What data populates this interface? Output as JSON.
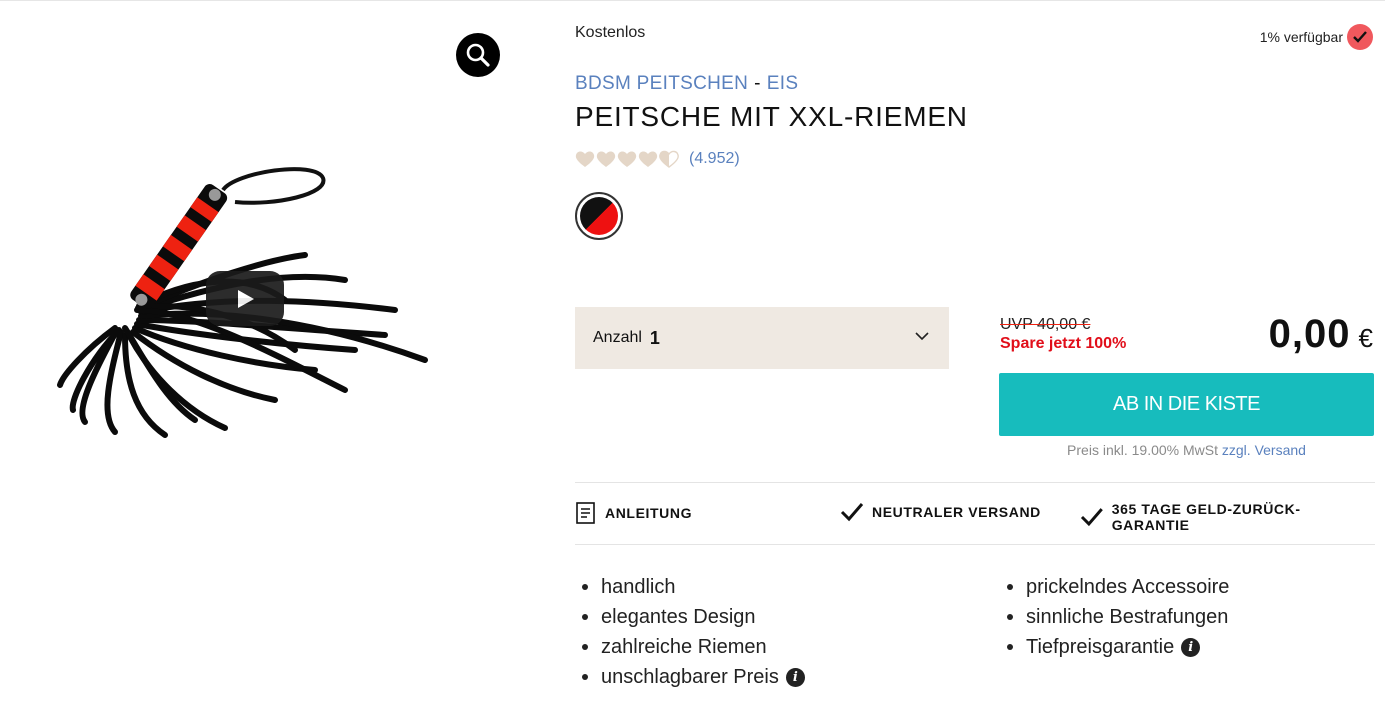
{
  "media": {
    "zoom_icon": "magnifier-icon",
    "play_icon": "play-icon"
  },
  "availability_label": "Kostenlos",
  "stock": {
    "label": "1% verfügbar",
    "icon": "check-icon",
    "color": "#f0585d"
  },
  "breadcrumb": {
    "category": "BDSM PEITSCHEN",
    "separator": "-",
    "brand": "EIS"
  },
  "product": {
    "title": "PEITSCHE MIT XXL-RIEMEN",
    "rating_value": 4.5,
    "rating_count": "(4.952)",
    "color_swatch": "black-red"
  },
  "quantity": {
    "label": "Anzahl",
    "value": "1"
  },
  "pricing": {
    "uvp": "UVP 40,00 €",
    "save_prefix": "Spare jetzt",
    "save_percent": "100%",
    "price": "0,00",
    "currency": "€",
    "cart_button": "AB IN DIE KISTE",
    "tax_text": "Preis inkl. 19.00% MwSt",
    "shipping_prefix": "zzgl.",
    "shipping_link": "Versand",
    "accent": "#17bcbd"
  },
  "features": {
    "manual": "ANLEITUNG",
    "neutral_shipping": "NEUTRALER VERSAND",
    "guarantee": "365 TAGE GELD-ZURÜCK-GARANTIE"
  },
  "bullets_left": [
    "handlich",
    "elegantes Design",
    "zahlreiche Riemen",
    "unschlagbarer Preis"
  ],
  "bullets_right": [
    "prickelndes Accessoire",
    "sinnliche Bestrafungen",
    "Tiefpreisgarantie"
  ]
}
